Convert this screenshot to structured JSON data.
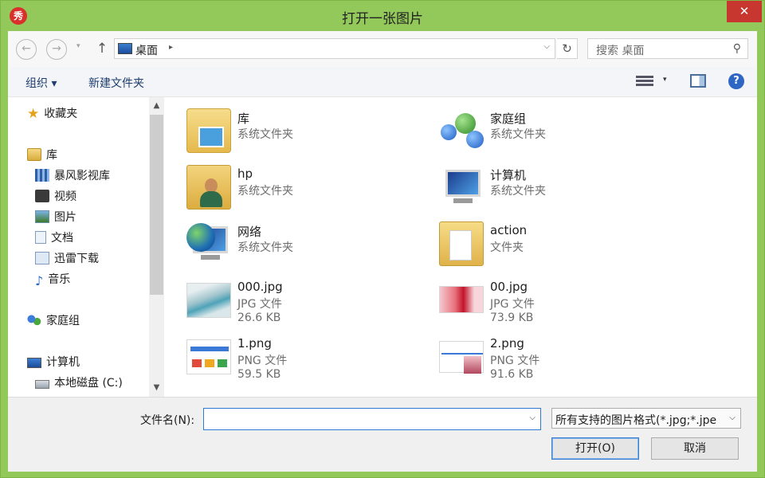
{
  "window": {
    "title": "打开一张图片",
    "app_icon_text": "秀",
    "close_glyph": "✕"
  },
  "address_bar": {
    "back_glyph": "←",
    "forward_glyph": "→",
    "recent_glyph": "▾",
    "up_glyph": "↑",
    "location": "桌面",
    "location_caret": "▸",
    "dropdown_glyph": "⌵",
    "refresh_glyph": "↻",
    "search_placeholder": "搜索 桌面",
    "search_glyph": "⚲"
  },
  "toolbar": {
    "organize_label": "组织 ▾",
    "new_folder_label": "新建文件夹",
    "view_drop_glyph": "▾",
    "help_glyph": "?"
  },
  "nav_pane": {
    "items": [
      {
        "label": "收藏夹",
        "icon": "star-icon"
      },
      {
        "label": "库",
        "icon": "library-icon"
      },
      {
        "label": "暴风影视库",
        "icon": "film-library-icon"
      },
      {
        "label": "视频",
        "icon": "video-icon"
      },
      {
        "label": "图片",
        "icon": "pictures-icon"
      },
      {
        "label": "文档",
        "icon": "documents-icon"
      },
      {
        "label": "迅雷下载",
        "icon": "download-icon"
      },
      {
        "label": "音乐",
        "icon": "music-icon"
      },
      {
        "label": "家庭组",
        "icon": "homegroup-icon"
      },
      {
        "label": "计算机",
        "icon": "computer-icon"
      },
      {
        "label": "本地磁盘 (C:)",
        "icon": "disk-icon"
      }
    ],
    "scroll_up_glyph": "▲",
    "scroll_down_glyph": "▼"
  },
  "files": [
    {
      "name": "库",
      "type": "系统文件夹",
      "size": "",
      "icon": "library-folder-icon"
    },
    {
      "name": "家庭组",
      "type": "系统文件夹",
      "size": "",
      "icon": "homegroup-icon"
    },
    {
      "name": "hp",
      "type": "系统文件夹",
      "size": "",
      "icon": "user-folder-icon"
    },
    {
      "name": "计算机",
      "type": "系统文件夹",
      "size": "",
      "icon": "computer-icon"
    },
    {
      "name": "网络",
      "type": "系统文件夹",
      "size": "",
      "icon": "network-icon"
    },
    {
      "name": "action",
      "type": "文件夹",
      "size": "",
      "icon": "folder-icon"
    },
    {
      "name": "000.jpg",
      "type": "JPG 文件",
      "size": "26.6 KB",
      "icon": "image-thumbnail"
    },
    {
      "name": "00.jpg",
      "type": "JPG 文件",
      "size": "73.9 KB",
      "icon": "image-thumbnail"
    },
    {
      "name": "1.png",
      "type": "PNG 文件",
      "size": "59.5 KB",
      "icon": "image-thumbnail"
    },
    {
      "name": "2.png",
      "type": "PNG 文件",
      "size": "91.6 KB",
      "icon": "image-thumbnail"
    }
  ],
  "footer": {
    "filename_label": "文件名(N):",
    "filename_value": "",
    "filename_drop_glyph": "⌵",
    "filter_value": "所有支持的图片格式(*.jpg;*.jpe",
    "filter_drop_glyph": "⌵",
    "open_label": "打开(O)",
    "cancel_label": "取消"
  },
  "colors": {
    "frame": "#93c85a",
    "close": "#c7372f",
    "accent": "#2e7ad2"
  }
}
